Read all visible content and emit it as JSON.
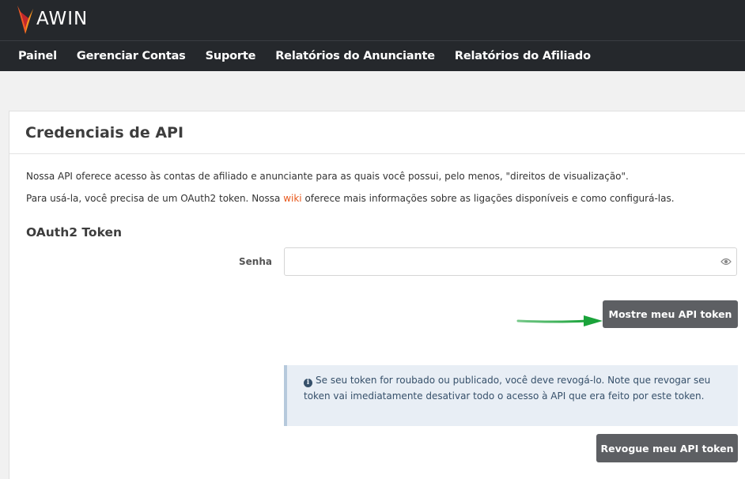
{
  "brand": {
    "logo_text": "AWIN"
  },
  "nav": {
    "items": [
      {
        "label": "Painel"
      },
      {
        "label": "Gerenciar Contas"
      },
      {
        "label": "Suporte"
      },
      {
        "label": "Relatórios do Anunciante"
      },
      {
        "label": "Relatórios do Afiliado"
      }
    ]
  },
  "card": {
    "title": "Credenciais de API",
    "intro": "Nossa API oferece acesso às contas de afiliado e anunciante para as quais você possui, pelo menos, \"direitos de visualização\".",
    "usage_before": "Para usá-la, você precisa de um OAuth2 token. Nossa ",
    "usage_link": "wiki",
    "usage_after": " oferece mais informações sobre as ligações disponíveis e como configurá-las.",
    "section_title": "OAuth2 Token",
    "password_label": "Senha",
    "password_value": "",
    "show_button": "Mostre meu API token",
    "alert_text": "Se seu token for roubado ou publicado, você deve revogá-lo. Note que revogar seu token vai imediatamente desativar todo o acesso à API que era feito por este token.",
    "revoke_button": "Revogue meu API token"
  },
  "colors": {
    "nav_bg": "#25282c",
    "link": "#e8571b",
    "button": "#5d5f63",
    "alert_bg": "#e8eef5",
    "arrow": "#1aa33a"
  }
}
